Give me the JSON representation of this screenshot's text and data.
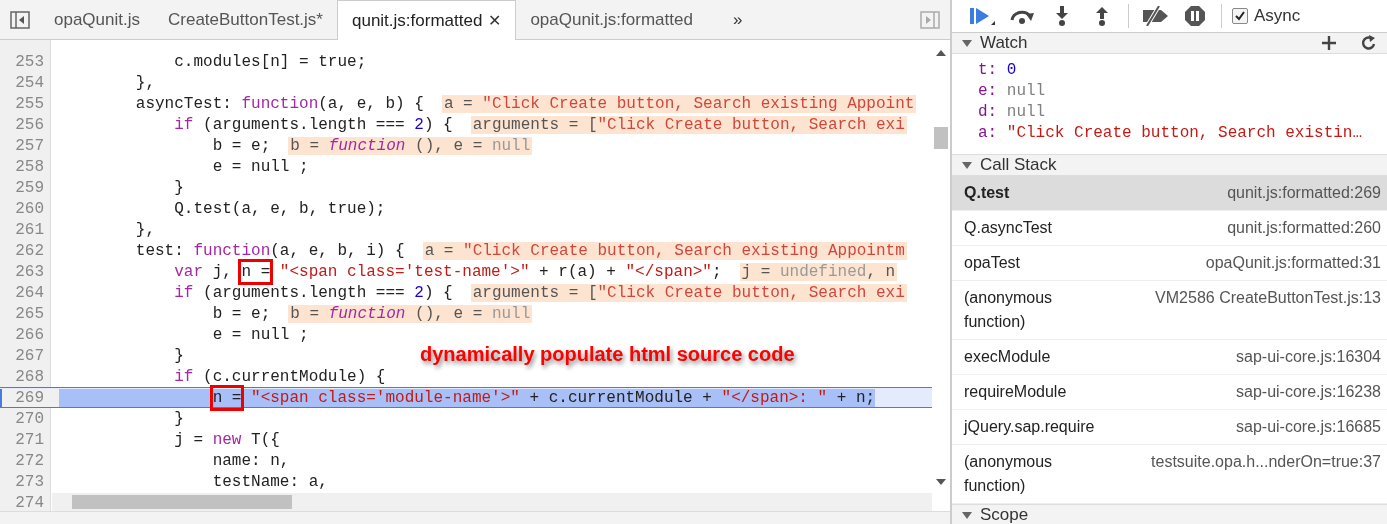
{
  "tabs": [
    {
      "label": "opaQunit.js",
      "selected": false
    },
    {
      "label": "CreateButtonTest.js*",
      "selected": false
    },
    {
      "label": "qunit.js:formatted",
      "selected": true,
      "close": "✕"
    },
    {
      "label": "opaQunit.js:formatted",
      "selected": false
    }
  ],
  "more_tabs": "»",
  "code": {
    "lines": [
      {
        "number": "253",
        "current": false,
        "tokens": [
          {
            "kind": "plain",
            "text": "            c.modules[n] = true;"
          }
        ]
      },
      {
        "number": "254",
        "current": false,
        "tokens": [
          {
            "kind": "plain",
            "text": "        },"
          }
        ]
      },
      {
        "number": "255",
        "current": false,
        "tokens": [
          {
            "kind": "plain",
            "text": "        asyncTest: "
          },
          {
            "kind": "keyword",
            "text": "function"
          },
          {
            "kind": "plain",
            "text": "(a, e, b) {"
          }
        ],
        "hint": [
          {
            "kind": "plain",
            "text": "a = "
          },
          {
            "kind": "string",
            "text": "\"Click Create button, Search existing Appoint"
          }
        ]
      },
      {
        "number": "256",
        "current": false,
        "tokens": [
          {
            "kind": "keyword",
            "text": "            if"
          },
          {
            "kind": "plain",
            "text": " (arguments.length === "
          },
          {
            "kind": "number",
            "text": "2"
          },
          {
            "kind": "plain",
            "text": ") {"
          }
        ],
        "hint": [
          {
            "kind": "plain",
            "text": "arguments = ["
          },
          {
            "kind": "string",
            "text": "\"Click Create button, Search exi"
          }
        ]
      },
      {
        "number": "257",
        "current": false,
        "tokens": [
          {
            "kind": "plain",
            "text": "                b = e;"
          }
        ],
        "hint": [
          {
            "kind": "plain",
            "text": "b = "
          },
          {
            "kind": "italic",
            "text": "function"
          },
          {
            "kind": "plain",
            "text": " (), e = "
          },
          {
            "kind": "null",
            "text": "null"
          }
        ]
      },
      {
        "number": "258",
        "current": false,
        "tokens": [
          {
            "kind": "plain",
            "text": "                e = null ;"
          }
        ]
      },
      {
        "number": "259",
        "current": false,
        "tokens": [
          {
            "kind": "plain",
            "text": "            }"
          }
        ]
      },
      {
        "number": "260",
        "current": false,
        "tokens": [
          {
            "kind": "plain",
            "text": "            Q.test(a, e, b, true);"
          }
        ]
      },
      {
        "number": "261",
        "current": false,
        "tokens": [
          {
            "kind": "plain",
            "text": "        },"
          }
        ]
      },
      {
        "number": "262",
        "current": false,
        "tokens": [
          {
            "kind": "plain",
            "text": "        test: "
          },
          {
            "kind": "keyword",
            "text": "function"
          },
          {
            "kind": "plain",
            "text": "(a, e, b, i) {"
          }
        ],
        "hint": [
          {
            "kind": "plain",
            "text": "a = "
          },
          {
            "kind": "string",
            "text": "\"Click Create button, Search existing Appointm"
          }
        ]
      },
      {
        "number": "263",
        "current": false,
        "tokens": [
          {
            "kind": "keyword",
            "text": "            var"
          },
          {
            "kind": "plain",
            "text": " j, "
          },
          {
            "kind": "plain",
            "text": "n =",
            "boxed": true
          },
          {
            "kind": "string",
            "text": " \"<span class='test-name'>\""
          },
          {
            "kind": "plain",
            "text": " + r(a) + "
          },
          {
            "kind": "string",
            "text": "\"</span>\""
          },
          {
            "kind": "plain",
            "text": ";"
          }
        ],
        "hint": [
          {
            "kind": "plain",
            "text": "j = "
          },
          {
            "kind": "null",
            "text": "undefined"
          },
          {
            "kind": "plain",
            "text": ", n"
          }
        ]
      },
      {
        "number": "264",
        "current": false,
        "tokens": [
          {
            "kind": "keyword",
            "text": "            if"
          },
          {
            "kind": "plain",
            "text": " (arguments.length === "
          },
          {
            "kind": "number",
            "text": "2"
          },
          {
            "kind": "plain",
            "text": ") {"
          }
        ],
        "hint": [
          {
            "kind": "plain",
            "text": "arguments = ["
          },
          {
            "kind": "string",
            "text": "\"Click Create button, Search exi"
          }
        ]
      },
      {
        "number": "265",
        "current": false,
        "tokens": [
          {
            "kind": "plain",
            "text": "                b = e;"
          }
        ],
        "hint": [
          {
            "kind": "plain",
            "text": "b = "
          },
          {
            "kind": "italic",
            "text": "function"
          },
          {
            "kind": "plain",
            "text": " (), e = "
          },
          {
            "kind": "null",
            "text": "null"
          }
        ]
      },
      {
        "number": "266",
        "current": false,
        "tokens": [
          {
            "kind": "plain",
            "text": "                e = null ;"
          }
        ]
      },
      {
        "number": "267",
        "current": false,
        "tokens": [
          {
            "kind": "plain",
            "text": "            }"
          }
        ]
      },
      {
        "number": "268",
        "current": false,
        "tokens": [
          {
            "kind": "keyword",
            "text": "            if"
          },
          {
            "kind": "plain",
            "text": " (c.currentModule) {"
          }
        ]
      },
      {
        "number": "269",
        "current": true,
        "tokens": [
          {
            "kind": "plain",
            "text": "                n =",
            "boxed": true
          },
          {
            "kind": "string",
            "text": " \"<span class='module-name'>\""
          },
          {
            "kind": "plain",
            "text": " + c.currentModule + "
          },
          {
            "kind": "string",
            "text": "\"</span>: \""
          },
          {
            "kind": "plain",
            "text": " + n;"
          }
        ]
      },
      {
        "number": "270",
        "current": false,
        "tokens": [
          {
            "kind": "plain",
            "text": "            }"
          }
        ]
      },
      {
        "number": "271",
        "current": false,
        "tokens": [
          {
            "kind": "plain",
            "text": "            j = "
          },
          {
            "kind": "keyword",
            "text": "new"
          },
          {
            "kind": "plain",
            "text": " T({"
          }
        ]
      },
      {
        "number": "272",
        "current": false,
        "tokens": [
          {
            "kind": "plain",
            "text": "                name: n,"
          }
        ]
      },
      {
        "number": "273",
        "current": false,
        "tokens": [
          {
            "kind": "plain",
            "text": "                testName: a,"
          }
        ]
      },
      {
        "number": "274",
        "current": false
      }
    ],
    "annotation": "dynamically populate html source code"
  },
  "debugger": {
    "async": {
      "label": "Async",
      "checked": true
    },
    "watch": {
      "title": "Watch",
      "expanded": true,
      "items": [
        {
          "name": "t:",
          "kind": "number",
          "value": "0"
        },
        {
          "name": "e:",
          "kind": "null",
          "value": "null"
        },
        {
          "name": "d:",
          "kind": "null",
          "value": "null"
        },
        {
          "name": "a:",
          "kind": "string",
          "value": "\"Click Create button, Search existin…"
        }
      ]
    },
    "call_stack": {
      "title": "Call Stack",
      "expanded": true,
      "frames": [
        {
          "name": "Q.test",
          "location": "qunit.js:formatted:269",
          "selected": true
        },
        {
          "name": "Q.asyncTest",
          "location": "qunit.js:formatted:260",
          "selected": false
        },
        {
          "name": "opaTest",
          "location": "opaQunit.js:formatted:31",
          "selected": false
        },
        {
          "name": "(anonymous function)",
          "location": "VM2586 CreateButtonTest.js:13",
          "selected": false
        },
        {
          "name": "execModule",
          "location": "sap-ui-core.js:16304",
          "selected": false
        },
        {
          "name": "requireModule",
          "location": "sap-ui-core.js:16238",
          "selected": false
        },
        {
          "name": "jQuery.sap.require",
          "location": "sap-ui-core.js:16685",
          "selected": false
        },
        {
          "name": "(anonymous function)",
          "location": "testsuite.opa.h...nderOn=true:37",
          "selected": false
        }
      ]
    },
    "scope": {
      "title": "Scope",
      "expanded": true
    }
  }
}
